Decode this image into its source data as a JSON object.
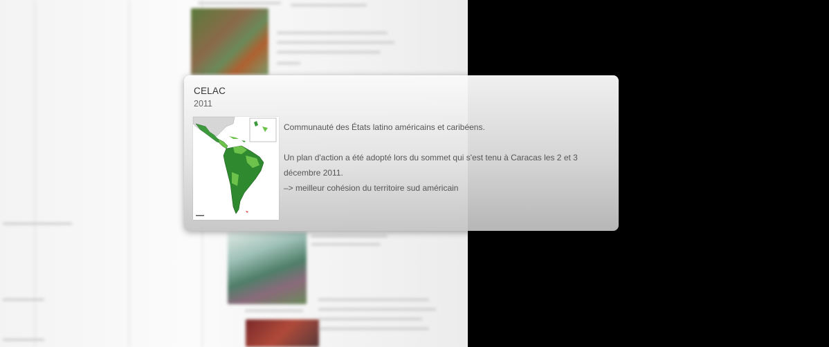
{
  "popup": {
    "title": "CELAC",
    "year": "2011",
    "description": {
      "line1": "Communauté des États latino américains et caribéens.",
      "line2": "Un plan d'action a été adopté lors du sommet qui s'est tenu à Caracas les 2 et 3 décembre 2011.",
      "line3": "–> meilleur cohésion du territoire sud américain"
    }
  },
  "colors": {
    "background": "#000000",
    "card_top": "#fafafa",
    "card_bottom": "#c4c4c4",
    "map_member_dark": "#2f8a2f",
    "map_member_light": "#6cc24a",
    "map_other": "#d6d6d6"
  },
  "icons": {
    "map": "latin-america-map"
  }
}
